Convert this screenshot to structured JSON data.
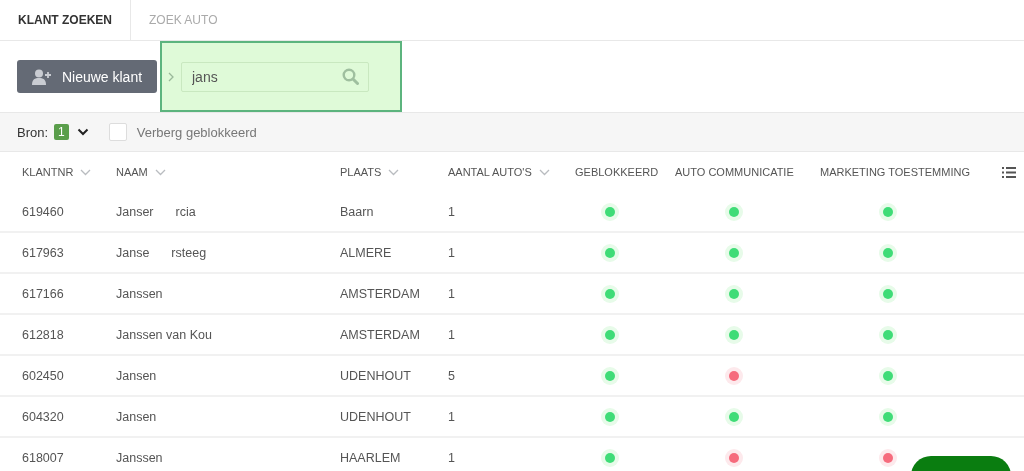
{
  "tabs": [
    {
      "label": "KLANT ZOEKEN",
      "selected": true
    },
    {
      "label": "ZOEK AUTO",
      "selected": false
    }
  ],
  "new_button": {
    "label": "Nieuwe klant"
  },
  "search": {
    "value": "jans",
    "highlighted": true
  },
  "filters": {
    "bron_label": "Bron:",
    "bron_count": "1",
    "hide_blocked": {
      "label": "Verberg geblokkeerd",
      "checked": false
    }
  },
  "table": {
    "columns": [
      {
        "label": "KLANTNR",
        "sortable": true
      },
      {
        "label": "NAAM",
        "sortable": true
      },
      {
        "label": "PLAATS",
        "sortable": true
      },
      {
        "label": "AANTAL AUTO'S",
        "sortable": true
      },
      {
        "label": "GEBLOKKEERD",
        "sortable": false
      },
      {
        "label": "AUTO COMMUNICATIE",
        "sortable": false
      },
      {
        "label": "MARKETING TOESTEMMING",
        "sortable": false
      }
    ],
    "rows": [
      {
        "klantnr": "619460",
        "naam": [
          "Janser",
          "rcia"
        ],
        "plaats": "Baarn",
        "autos": "1",
        "geblokkeerd": true,
        "auto_communicatie": true,
        "marketing": true
      },
      {
        "klantnr": "617963",
        "naam": [
          "Janse",
          "rsteeg"
        ],
        "plaats": "ALMERE",
        "autos": "1",
        "geblokkeerd": true,
        "auto_communicatie": true,
        "marketing": true
      },
      {
        "klantnr": "617166",
        "naam": [
          "Janssen"
        ],
        "plaats": "AMSTERDAM",
        "autos": "1",
        "geblokkeerd": true,
        "auto_communicatie": true,
        "marketing": true
      },
      {
        "klantnr": "612818",
        "naam": [
          "Janssen van Kou"
        ],
        "plaats": "AMSTERDAM",
        "autos": "1",
        "geblokkeerd": true,
        "auto_communicatie": true,
        "marketing": true
      },
      {
        "klantnr": "602450",
        "naam": [
          "Jansen"
        ],
        "plaats": "UDENHOUT",
        "autos": "5",
        "geblokkeerd": true,
        "auto_communicatie": false,
        "marketing": true
      },
      {
        "klantnr": "604320",
        "naam": [
          "Jansen"
        ],
        "plaats": "UDENHOUT",
        "autos": "1",
        "geblokkeerd": true,
        "auto_communicatie": true,
        "marketing": true
      },
      {
        "klantnr": "618007",
        "naam": [
          "Janssen"
        ],
        "plaats": "HAARLEM",
        "autos": "1",
        "geblokkeerd": true,
        "auto_communicatie": false,
        "marketing": false
      }
    ]
  }
}
